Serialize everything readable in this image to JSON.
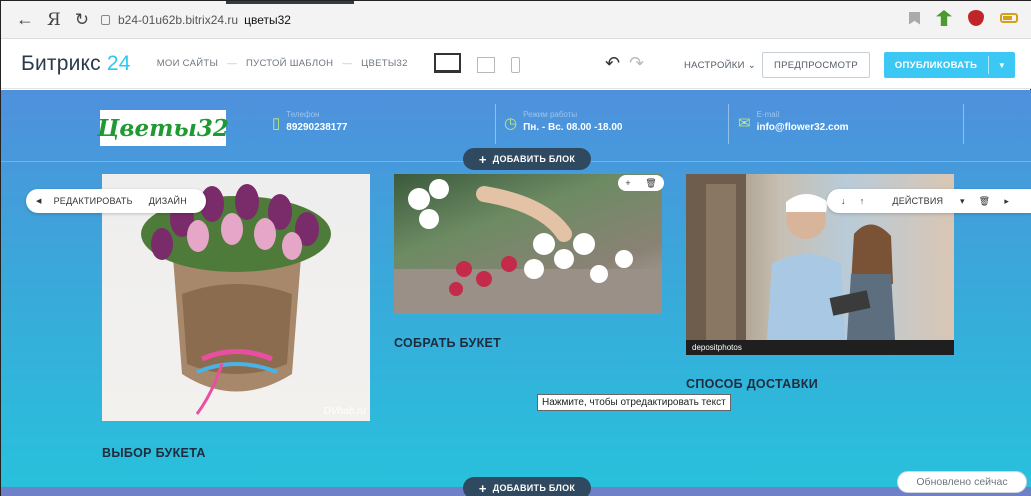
{
  "browser": {
    "back_icon": "arrow-left-icon",
    "yandex_label": "Я",
    "reload_icon": "reload-icon",
    "url_host": "b24-01u62b.bitrix24.ru",
    "page_title": "цветы32"
  },
  "toolbar": {
    "logo_text": "Битрикс",
    "logo_num": "24",
    "breadcrumbs": [
      "МОИ САЙТЫ",
      "ПУСТОЙ ШАБЛОН",
      "ЦВЕТЫ32"
    ],
    "breadcrumb_sep": "—",
    "settings_label": "НАСТРОЙКИ",
    "preview_label": "ПРЕДПРОСМОТР",
    "publish_label": "ОПУБЛИКОВАТЬ"
  },
  "site": {
    "logo_text": "Цветы32",
    "contacts": [
      {
        "icon": "phone-icon",
        "label": "Телефон",
        "value": "89290238177"
      },
      {
        "icon": "clock-icon",
        "label": "Режим работы",
        "value": "Пн. - Вс. 08.00 -18.00"
      },
      {
        "icon": "mail-icon",
        "label": "E-mail",
        "value": "info@flower32.com"
      }
    ],
    "add_block_label": "ДОБАВИТЬ БЛОК",
    "edit_label": "РЕДАКТИРОВАТЬ",
    "design_label": "ДИЗАЙН",
    "actions_label": "ДЕЙСТВИЯ",
    "photo1_watermark": "DVhab.ru",
    "photo3_watermark": "depositphotos",
    "cards": [
      {
        "title": "ВЫБОР БУКЕТА"
      },
      {
        "title": "СОБРАТЬ БУКЕТ"
      },
      {
        "title": "СПОСОБ ДОСТАВКИ"
      }
    ],
    "tooltip_text": "Нажмите, чтобы отредактировать текст",
    "updated_label": "Обновлено сейчас"
  },
  "colors": {
    "accent": "#3bc8f5",
    "logo_green": "#1f9a33",
    "canvas_top": "#4f90dc",
    "canvas_bottom": "#27c2dc",
    "add_block_bg": "#2f4a60"
  }
}
